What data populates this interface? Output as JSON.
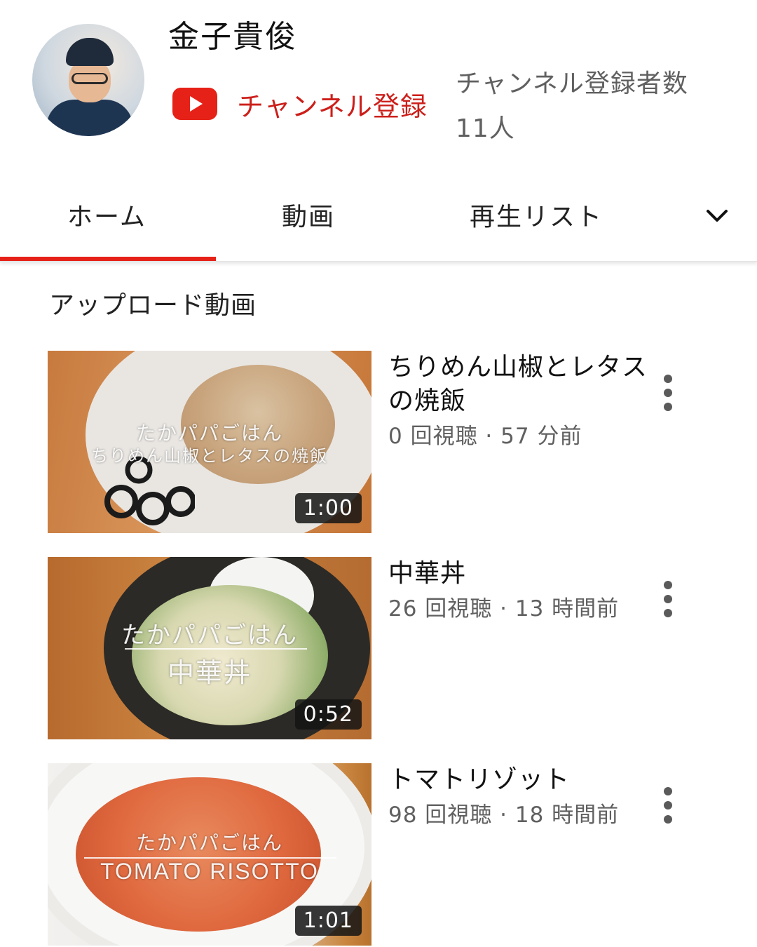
{
  "channel": {
    "name": "金子貴俊",
    "subscribe_label": "チャンネル登録",
    "subscriber_count": "チャンネル登録者数 11人",
    "brand_color": "#e62117"
  },
  "tabs": [
    {
      "label": "ホーム",
      "active": true
    },
    {
      "label": "動画",
      "active": false
    },
    {
      "label": "再生リスト",
      "active": false
    }
  ],
  "section": {
    "title": "アップロード動画"
  },
  "videos": [
    {
      "title": "ちりめん山椒とレタスの焼飯",
      "stats": "0 回視聴 · 57 分前",
      "duration": "1:00",
      "thumb_line1": "たかパパごはん",
      "thumb_line2": "ちりめん山椒とレタスの焼飯"
    },
    {
      "title": "中華丼",
      "stats": "26 回視聴 · 13 時間前",
      "duration": "0:52",
      "thumb_line1": "たかパパごはん",
      "thumb_line2": "中華丼"
    },
    {
      "title": "トマトリゾット",
      "stats": "98 回視聴 · 18 時間前",
      "duration": "1:01",
      "thumb_line1": "たかパパごはん",
      "thumb_line2": "TOMATO RISOTTO"
    }
  ],
  "icons": {
    "more": "chevron-down-icon",
    "menu": "more-vert-icon",
    "logo": "youtube-logo-icon"
  }
}
